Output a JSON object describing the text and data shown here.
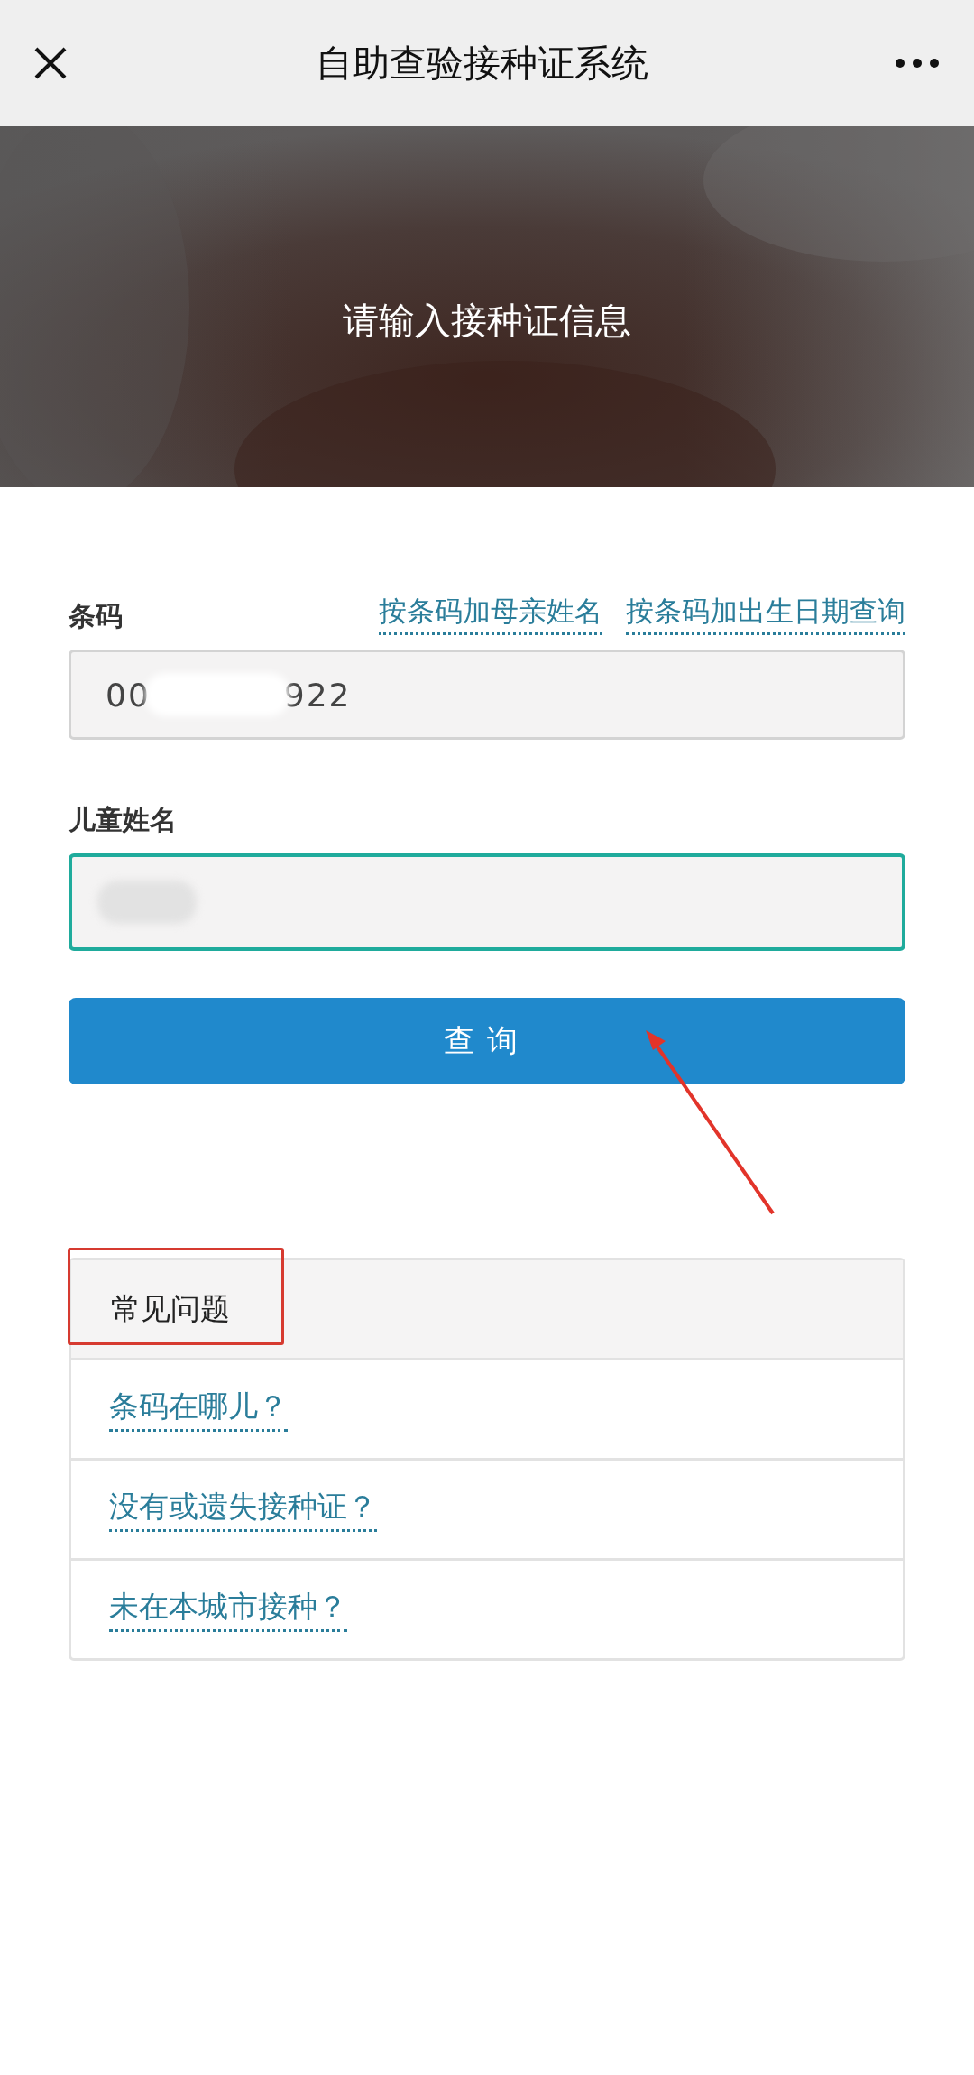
{
  "nav_bar": {
    "title": "自助查验接种证系统"
  },
  "banner": {
    "kind": "picture",
    "heading": "请输入接种证信息"
  },
  "form": {
    "links": [
      "按条码加母亲姓名",
      "按条码加出生日期查询"
    ],
    "fields": [
      {
        "label": "条码",
        "value_parts": [
          "00",
          "922"
        ],
        "redacted": true,
        "focused": false
      },
      {
        "label": "儿童姓名",
        "redacted": true,
        "focused": true
      }
    ],
    "submit_button": {
      "label": "查询",
      "arrow_annotation": true
    }
  },
  "faq": {
    "title": "常见问题",
    "box_annotation": true,
    "items": [
      "条码在哪儿？",
      "没有或遗失接种证？",
      "未在本城市接种？"
    ]
  }
}
